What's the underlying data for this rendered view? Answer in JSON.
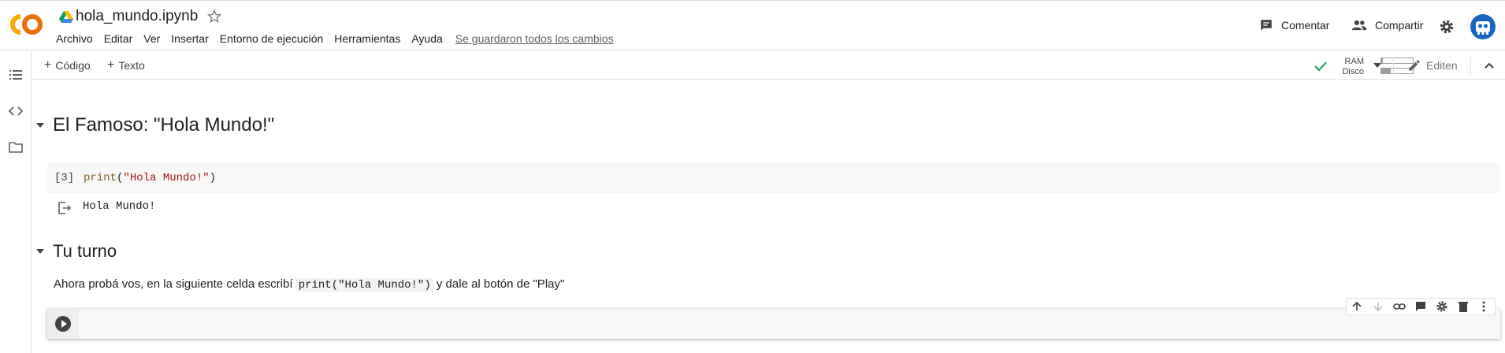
{
  "notebook": {
    "title": "hola_mundo.ipynb"
  },
  "menu": {
    "items": [
      "Archivo",
      "Editar",
      "Ver",
      "Insertar",
      "Entorno de ejecución",
      "Herramientas",
      "Ayuda"
    ],
    "save_status": "Se guardaron todos los cambios"
  },
  "header": {
    "comment_label": "Comentar",
    "share_label": "Compartir"
  },
  "toolbar": {
    "add_code_label": "Código",
    "add_text_label": "Texto",
    "ram_label": "RAM",
    "disk_label": "Disco",
    "ram_usage": 0.05,
    "disk_usage": 0.3,
    "edit_label": "Editen"
  },
  "cells": {
    "heading1": "El Famoso: \"Hola Mundo!\"",
    "code1": {
      "exec_count": "[3]",
      "fn": "print",
      "open": "(",
      "string": "\"Hola Mundo!\"",
      "close": ")",
      "output": "Hola Mundo!"
    },
    "heading2": "Tu turno",
    "text2": {
      "before": "Ahora probá vos, en la siguiente celda escribí",
      "code": "print(\"Hola Mundo!\")",
      "after": "y dale al botón de \"Play\""
    }
  },
  "colors": {
    "logo_orange": "#f9ab00",
    "check_green": "#0f9d58",
    "avatar_blue": "#1565c0"
  },
  "icons": [
    "colab-logo",
    "drive-icon",
    "star-icon",
    "comment-icon",
    "share-icon",
    "gear-icon",
    "toc-icon",
    "code-snippets-icon",
    "files-icon",
    "check-icon",
    "dropdown-icon",
    "pencil-icon",
    "collapse-icon",
    "output-icon",
    "play-icon"
  ]
}
